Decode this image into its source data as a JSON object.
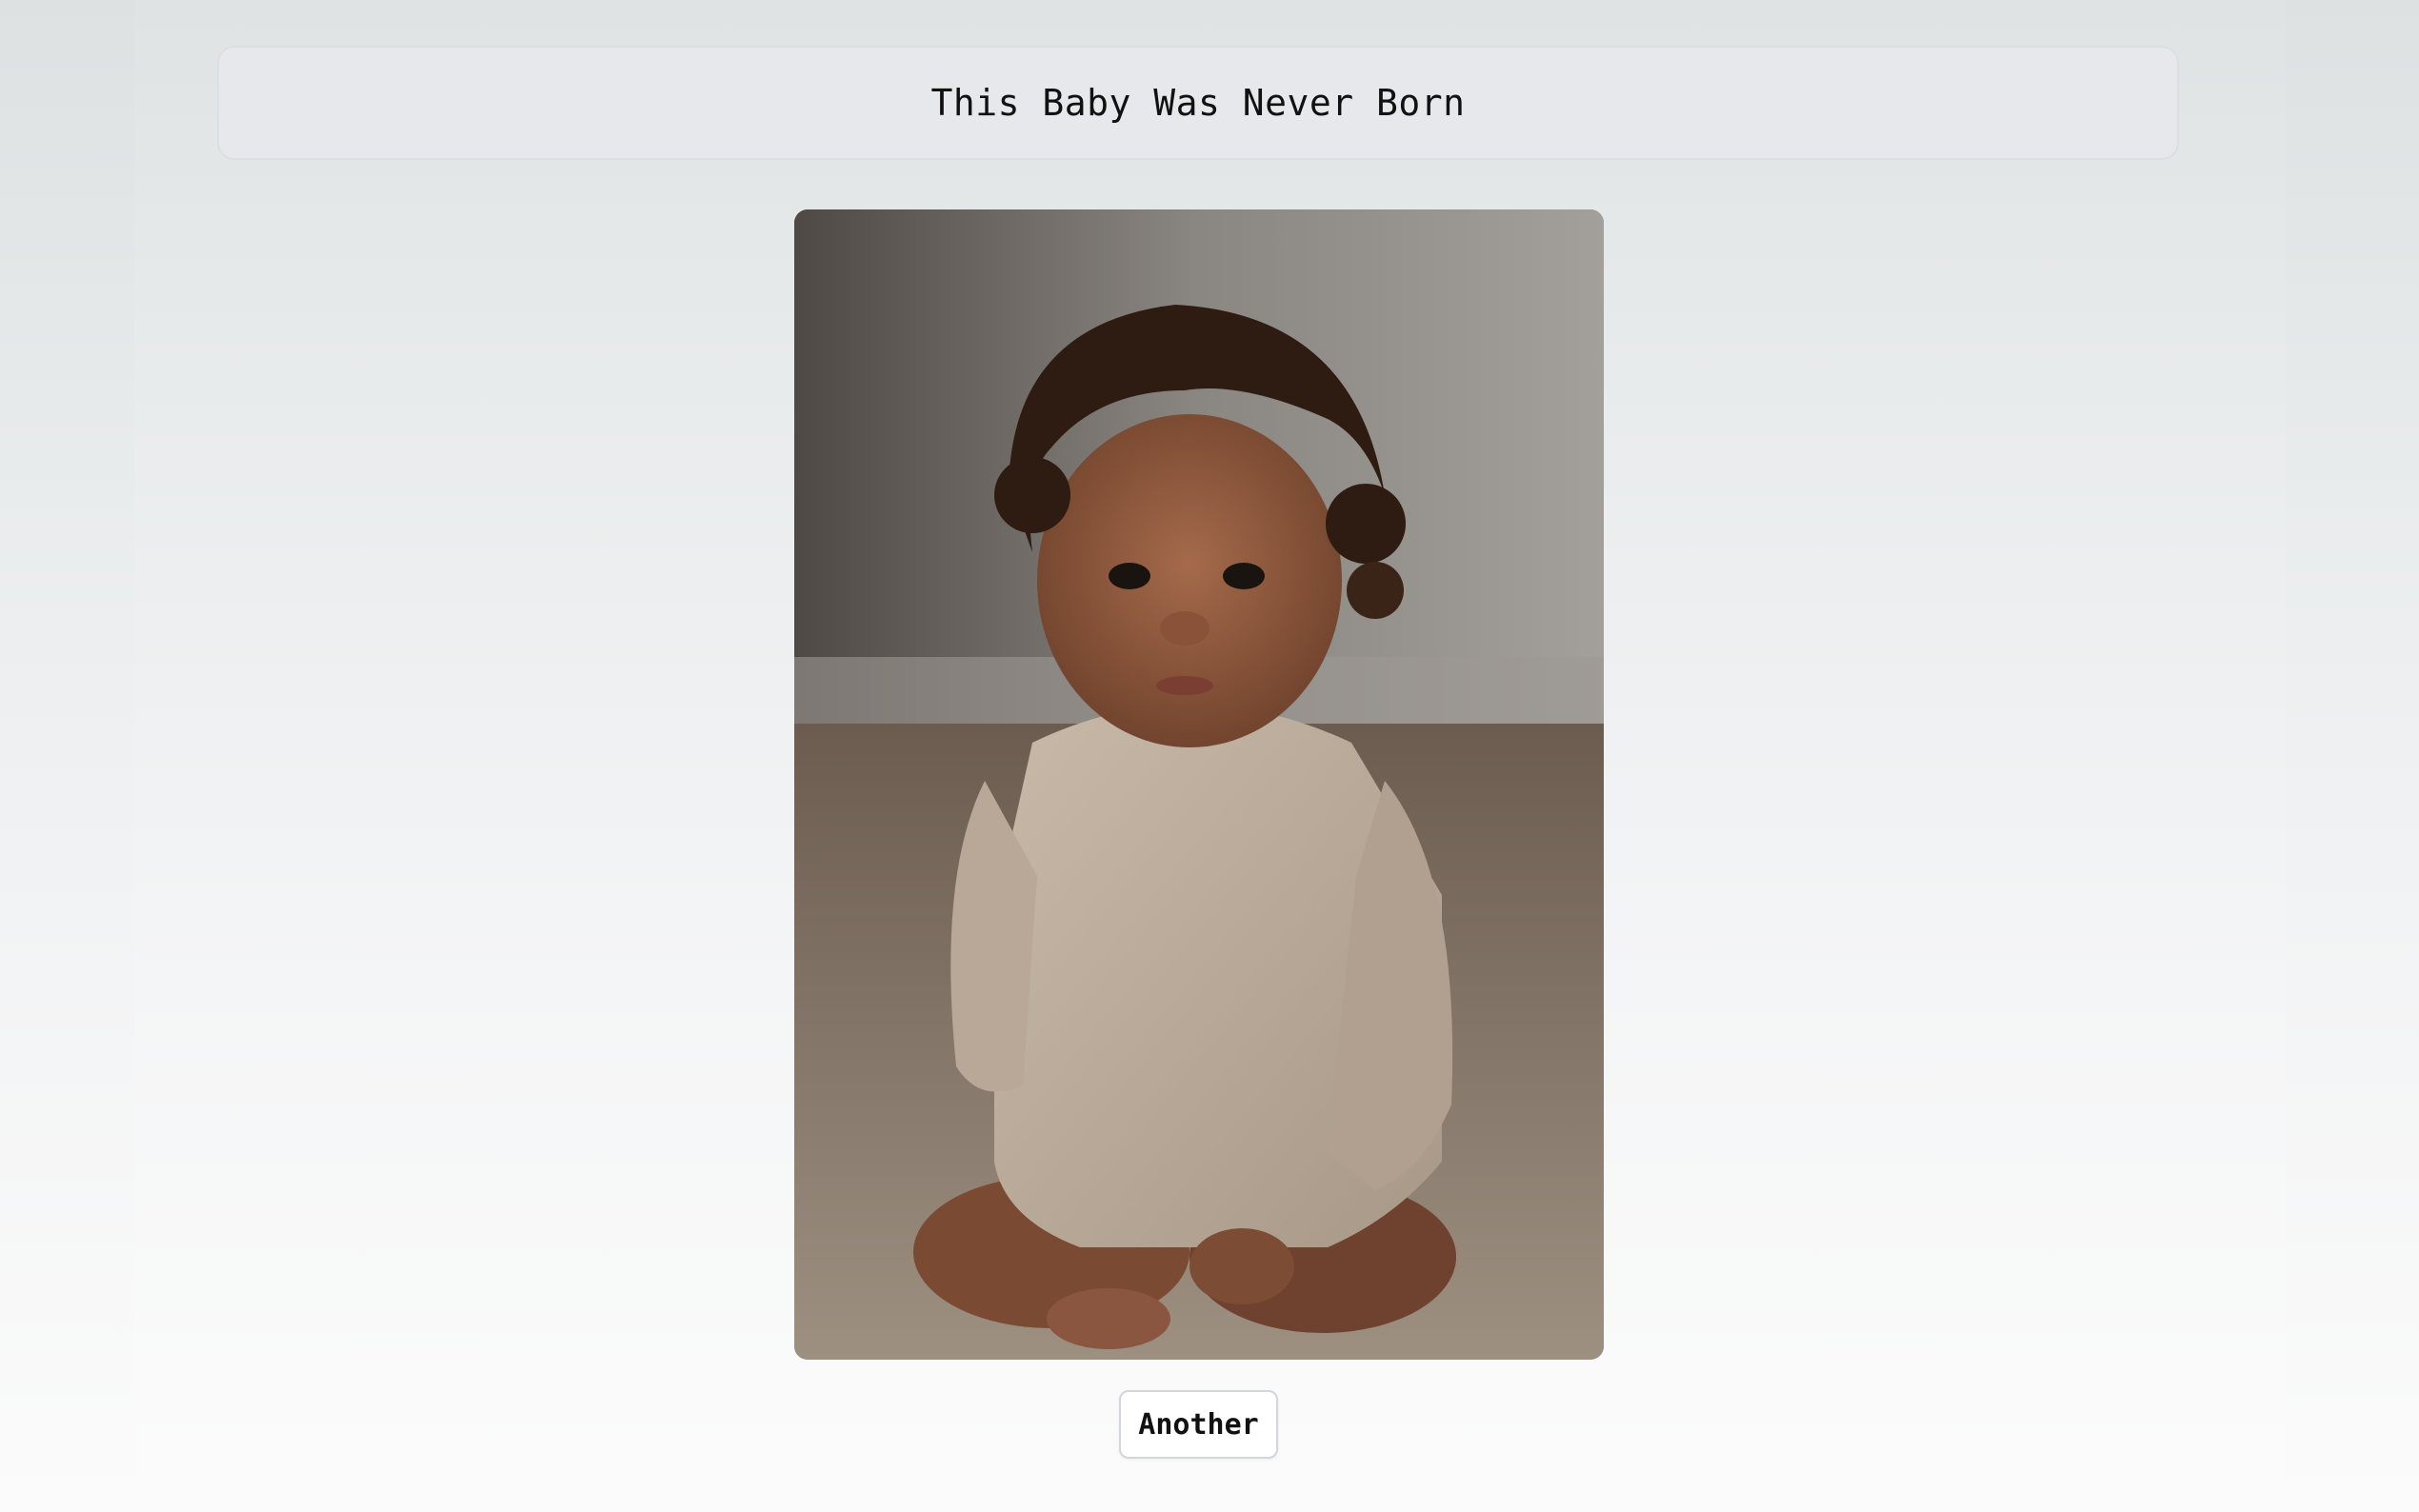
{
  "header": {
    "title": "This Baby Was Never Born"
  },
  "main": {
    "image_alt": "baby-photo",
    "another_label": "Another"
  },
  "colors": {
    "page_background_top": "#dde1e2",
    "page_background_bottom": "#fbfbfb",
    "title_bar_background": "#e6e8eb",
    "button_background": "#ffffff"
  }
}
